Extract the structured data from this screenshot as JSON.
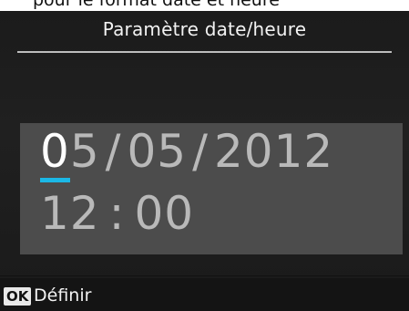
{
  "cutoff_text": "pour le format date et heure",
  "screen": {
    "title": "Paramètre date/heure",
    "date": {
      "cursor_digit": "0",
      "day_rest": "5",
      "sep1": "/",
      "month": "05",
      "sep2": "/",
      "year": "2012"
    },
    "time": {
      "hour": "12",
      "sep": ":",
      "minute": "00"
    },
    "footer": {
      "ok_key": "OK",
      "ok_label": "Définir"
    },
    "colors": {
      "cursor": "#1bb8e6",
      "panel": "#4c4c4c",
      "background": "#1b1b1b"
    }
  }
}
